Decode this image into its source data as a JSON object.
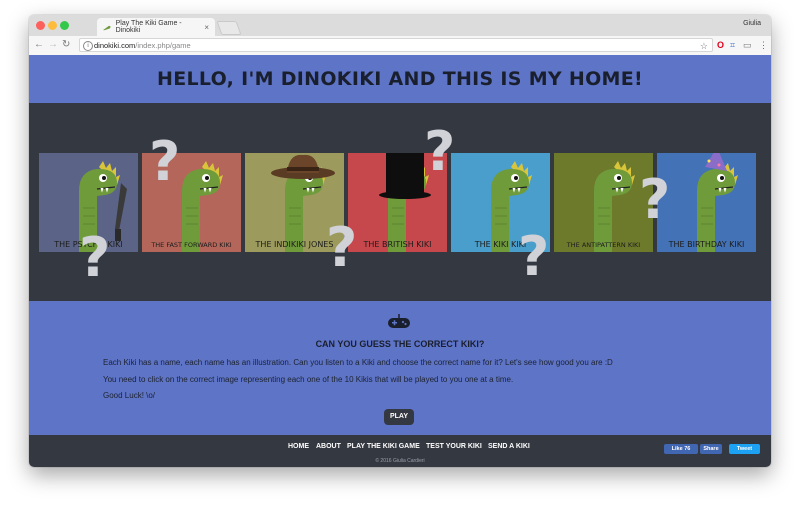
{
  "browser": {
    "tab_title": "Play The Kiki Game - Dinokiki",
    "user": "Giulia",
    "url_host": "dinokiki.com",
    "url_path": "/index.php/game",
    "colors": {
      "opera": "#e0001b",
      "tab_bar": "#dcdcdc"
    }
  },
  "page": {
    "headline": "HELLO, I'M DINOKIKI AND THIS IS MY HOME!",
    "colors": {
      "primary": "#5e74c7",
      "dark": "#343841",
      "dino_green": "#6f9b3b"
    },
    "kikis": [
      {
        "label": "THE PSYCHO KIKI",
        "bg": "#5b6486",
        "accessory": "knife"
      },
      {
        "label": "THE FAST FORWARD KIKI",
        "bg": "#b4665a",
        "accessory": "none"
      },
      {
        "label": "THE INDIKIKI JONES",
        "bg": "#9c9a5c",
        "accessory": "fedora"
      },
      {
        "label": "THE BRITISH KIKI",
        "bg": "#c7484c",
        "accessory": "top-hat"
      },
      {
        "label": "THE KIKI KIKI",
        "bg": "#4a9ecb",
        "accessory": "none"
      },
      {
        "label": "THE ANTIPATTERN KIKI",
        "bg": "#6e7a2b",
        "accessory": "none"
      },
      {
        "label": "THE BIRTHDAY KIKI",
        "bg": "#4472b6",
        "accessory": "party-hat"
      }
    ],
    "question_mark_icon": "?",
    "game": {
      "icon": "gamepad-icon",
      "title": "CAN YOU GUESS THE CORRECT KIKI?",
      "lines": [
        "Each Kiki has a name, each name has an illustration. Can you listen to a Kiki and choose the correct name for it? Let's see how good you are :D",
        "You need to click on the correct image representing each one of the 10 Kikis that will be played to you one at a time.",
        "Good Luck! \\o/"
      ],
      "play_label": "PLAY"
    },
    "footer": {
      "nav": [
        "HOME",
        "ABOUT",
        "PLAY THE KIKI GAME",
        "TEST YOUR KIKI",
        "SEND A KIKI"
      ],
      "copyright": "© 2016 Giulia Cardieri",
      "like_label": "Like 76",
      "share_label": "Share",
      "tweet_label": "Tweet"
    }
  }
}
